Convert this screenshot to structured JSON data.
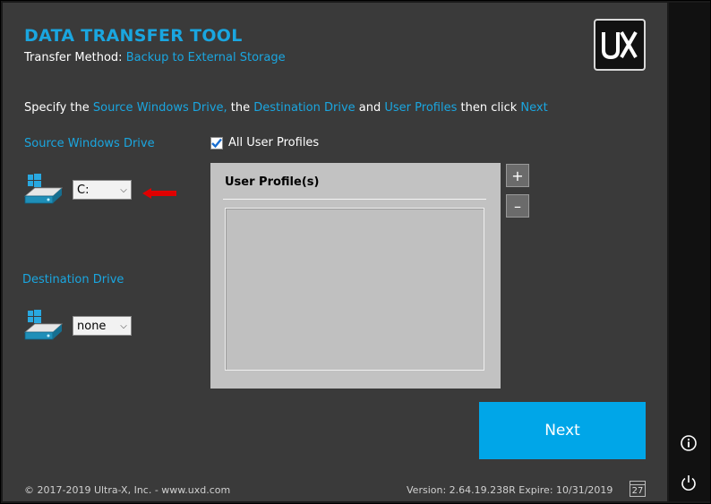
{
  "header": {
    "title": "DATA TRANSFER TOOL",
    "method_label": "Transfer Method:",
    "method_value": "Backup to External Storage",
    "logo_icon": "ux-logo-icon"
  },
  "instruction": {
    "p1": "Specify the ",
    "source": "Source Windows Drive,",
    "p2": " the ",
    "destination": "Destination Drive",
    "p3": " and ",
    "profiles": "User Profiles",
    "p4": " then click ",
    "next": "Next"
  },
  "source": {
    "label": "Source Windows Drive",
    "selected": "C:",
    "icon": "windows-drive-icon",
    "indicator": "red-arrow-icon"
  },
  "destination": {
    "label": "Destination Drive",
    "selected": "none",
    "icon": "windows-drive-icon"
  },
  "profiles": {
    "all_label": "All User Profiles",
    "all_checked": true,
    "header": "User Profile(s)",
    "items": [],
    "add_label": "+",
    "remove_label": "–"
  },
  "actions": {
    "next_label": "Next"
  },
  "footer": {
    "copyright": "© 2017-2019 Ultra-X, Inc. - www.uxd.com",
    "version": "Version: 2.64.19.238R Expire: 10/31/2019",
    "calendar_day": "27"
  },
  "sidebar": {
    "info_icon": "info-icon",
    "power_icon": "power-icon"
  },
  "colors": {
    "accent": "#1aa6e0",
    "next_button": "#00a6e8",
    "panel": "#3a3a3a"
  }
}
